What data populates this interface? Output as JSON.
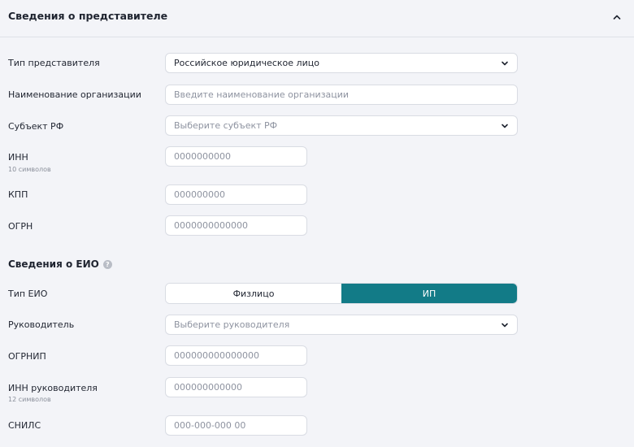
{
  "section": {
    "title": "Сведения о представителе",
    "collapse_icon": "chevron-up-icon"
  },
  "representative": {
    "type_label": "Тип представителя",
    "type_value": "Российское юридическое лицо",
    "org_name_label": "Наименование организации",
    "org_name_placeholder": "Введите наименование организации",
    "region_label": "Субъект РФ",
    "region_placeholder": "Выберите субъект РФ",
    "inn_label": "ИНН",
    "inn_hint": "10 символов",
    "inn_placeholder": "0000000000",
    "kpp_label": "КПП",
    "kpp_placeholder": "000000000",
    "ogrn_label": "ОГРН",
    "ogrn_placeholder": "0000000000000"
  },
  "eio": {
    "title": "Сведения о ЕИО",
    "help_icon": "question-circle-icon",
    "type_label": "Тип ЕИО",
    "type_options": [
      "Физлицо",
      "ИП"
    ],
    "type_selected": "ИП",
    "head_label": "Руководитель",
    "head_placeholder": "Выберите руководителя",
    "ogrnip_label": "ОГРНИП",
    "ogrnip_placeholder": "000000000000000",
    "head_inn_label": "ИНН руководителя",
    "head_inn_hint": "12 символов",
    "head_inn_placeholder": "000000000000",
    "snils_label": "СНИЛС",
    "snils_placeholder": "000-000-000 00"
  },
  "colors": {
    "accent": "#127b87",
    "background": "#f3f4f8",
    "border": "#d9dce3"
  }
}
